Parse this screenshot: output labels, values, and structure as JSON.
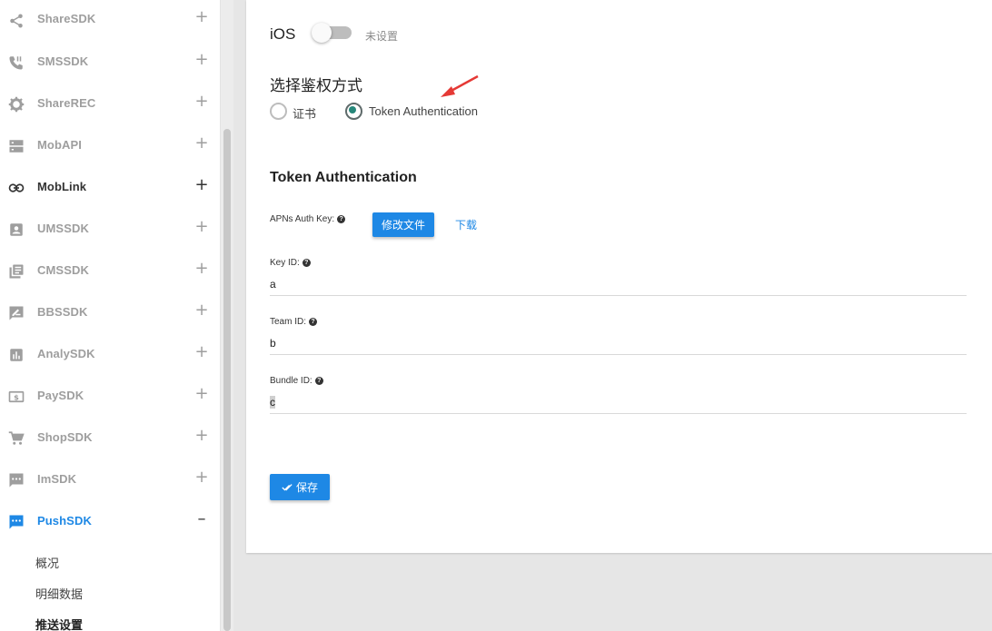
{
  "sidebar": {
    "items": [
      {
        "label": "ShareSDK",
        "toggle": "+"
      },
      {
        "label": "SMSSDK",
        "toggle": "+"
      },
      {
        "label": "ShareREC",
        "toggle": "+"
      },
      {
        "label": "MobAPI",
        "toggle": "+"
      },
      {
        "label": "MobLink",
        "toggle": "+"
      },
      {
        "label": "UMSSDK",
        "toggle": "+"
      },
      {
        "label": "CMSSDK",
        "toggle": "+"
      },
      {
        "label": "BBSSDK",
        "toggle": "+"
      },
      {
        "label": "AnalySDK",
        "toggle": "+"
      },
      {
        "label": "PaySDK",
        "toggle": "+"
      },
      {
        "label": "ShopSDK",
        "toggle": "+"
      },
      {
        "label": "ImSDK",
        "toggle": "+"
      },
      {
        "label": "PushSDK",
        "toggle": "–"
      }
    ],
    "subitems": [
      {
        "label": "概况"
      },
      {
        "label": "明细数据"
      },
      {
        "label": "推送设置"
      }
    ]
  },
  "main": {
    "ios_label": "iOS",
    "ios_toggle_status": "未设置",
    "auth_method_title": "选择鉴权方式",
    "auth_options": [
      {
        "label": "证书",
        "checked": false
      },
      {
        "label": "Token Authentication",
        "checked": true
      }
    ],
    "token_section_title": "Token Authentication",
    "apns_key_label": "APNs Auth Key:",
    "modify_file_button": "修改文件",
    "download_link": "下载",
    "key_id_label": "Key ID:",
    "key_id_value": "a",
    "team_id_label": "Team ID:",
    "team_id_value": "b",
    "bundle_id_label": "Bundle ID:",
    "bundle_id_value": "c",
    "save_button": "保存"
  },
  "colors": {
    "accent": "#1e88e5",
    "radio_checked": "#26877a",
    "arrow": "#e53935"
  }
}
